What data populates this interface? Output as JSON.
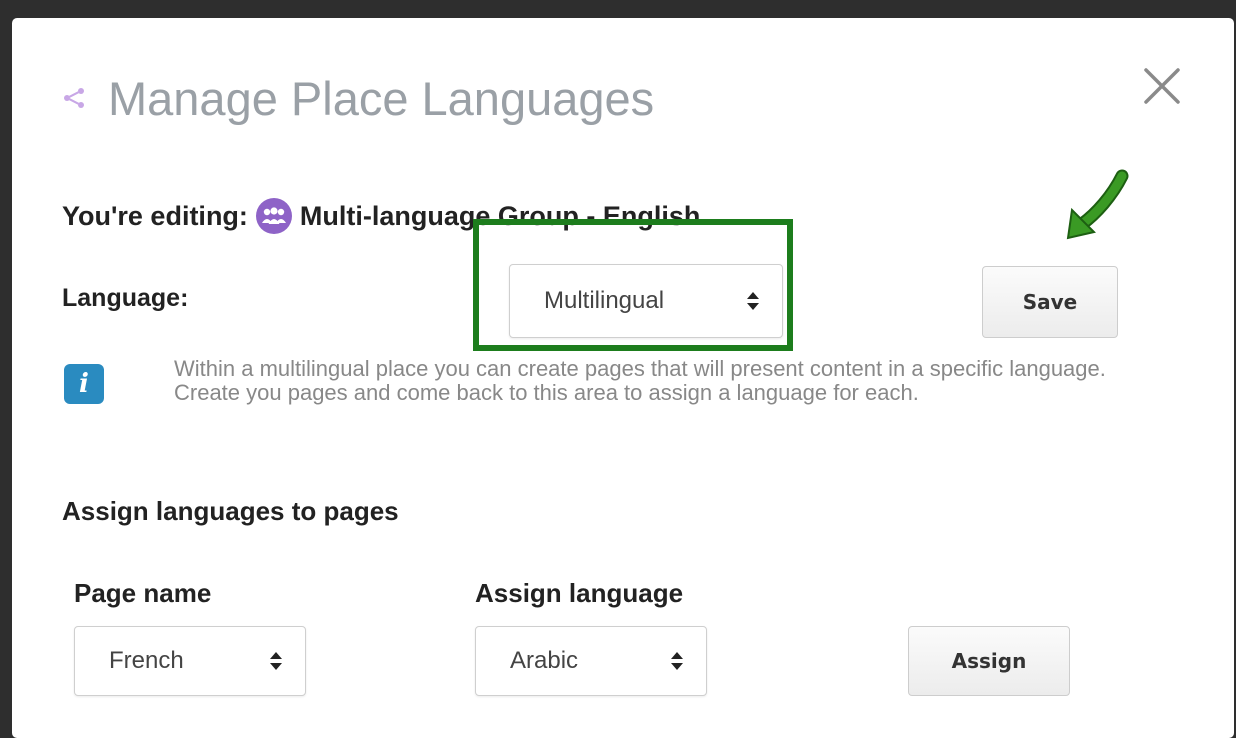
{
  "modal": {
    "title": "Manage Place Languages",
    "back_icon": "share-back-icon",
    "close_icon": "close-icon"
  },
  "editing": {
    "prefix": "You're editing:",
    "group_icon": "group-icon",
    "group_name": "Multi-language Group - English"
  },
  "language": {
    "label": "Language:",
    "selected": "Multilingual",
    "save_label": "Save"
  },
  "info": {
    "icon": "info-icon",
    "text": "Within a multilingual place you can create pages that will present content in a specific language. Create you pages and come back to this area to assign a language for each."
  },
  "assign": {
    "title": "Assign languages to pages",
    "page_name_header": "Page name",
    "assign_language_header": "Assign language",
    "page_selected": "French",
    "language_selected": "Arabic",
    "assign_label": "Assign"
  },
  "colors": {
    "highlight": "#1d7d1d",
    "arrow": "#2f8a1e",
    "group_icon": "#8e63c7",
    "info_icon": "#2a8bc0"
  }
}
